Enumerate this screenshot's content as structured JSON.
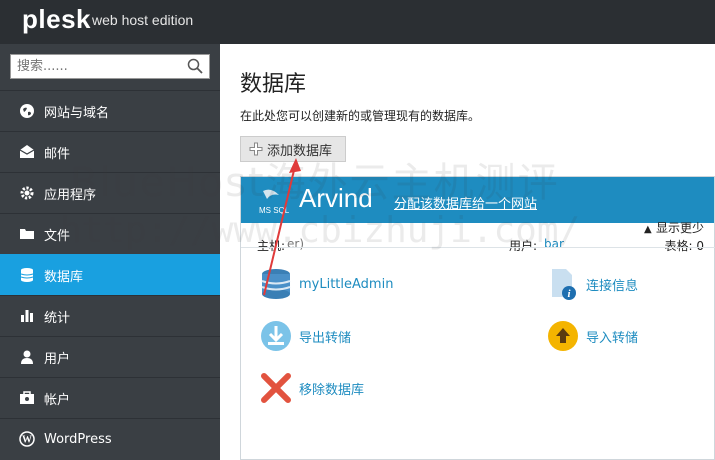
{
  "header": {
    "logo_text": "plesk",
    "edition": "web host edition"
  },
  "sidebar": {
    "search": {
      "value": "搜索......",
      "placeholder": "搜索......"
    },
    "items": [
      {
        "label": "网站与域名",
        "icon": "globe-icon"
      },
      {
        "label": "邮件",
        "icon": "mail-icon"
      },
      {
        "label": "应用程序",
        "icon": "gear-icon"
      },
      {
        "label": "文件",
        "icon": "folder-icon"
      },
      {
        "label": "数据库",
        "icon": "database-icon",
        "active": true
      },
      {
        "label": "统计",
        "icon": "bar-chart-icon"
      },
      {
        "label": "用户",
        "icon": "user-icon"
      },
      {
        "label": "帐户",
        "icon": "account-icon"
      },
      {
        "label": "WordPress",
        "icon": "wordpress-icon"
      }
    ]
  },
  "main": {
    "title": "数据库",
    "description": "在此处您可以创建新的或管理现有的数据库。",
    "add_button": "添加数据库",
    "database": {
      "logo_text": "MS SQL",
      "name": "Arvind",
      "assign_link": "分配该数据库给一个网站",
      "host_label": "主机:",
      "host_value": "                     er)",
      "user_label": "用户:",
      "user_value": "bar",
      "tables_label": "表格: 0",
      "show_less": "显示更少",
      "actions": [
        {
          "label": "myLittleAdmin",
          "icon": "database-stack-icon"
        },
        {
          "label": "连接信息",
          "icon": "info-document-icon"
        },
        {
          "label": "导出转储",
          "icon": "download-icon"
        },
        {
          "label": "导入转储",
          "icon": "upload-icon"
        },
        {
          "label": "移除数据库",
          "icon": "remove-icon"
        }
      ]
    }
  },
  "watermark": {
    "line1": "BlueHost海外云主机测评",
    "line2": "http://www.cbizhuji.com/"
  },
  "colors": {
    "topbar": "#2b2f33",
    "sidebar": "#3a3f44",
    "active": "#19a0e0",
    "panel_header": "#1e8cc0",
    "link": "#1e8cc0",
    "arrow": "#e03a3a"
  }
}
